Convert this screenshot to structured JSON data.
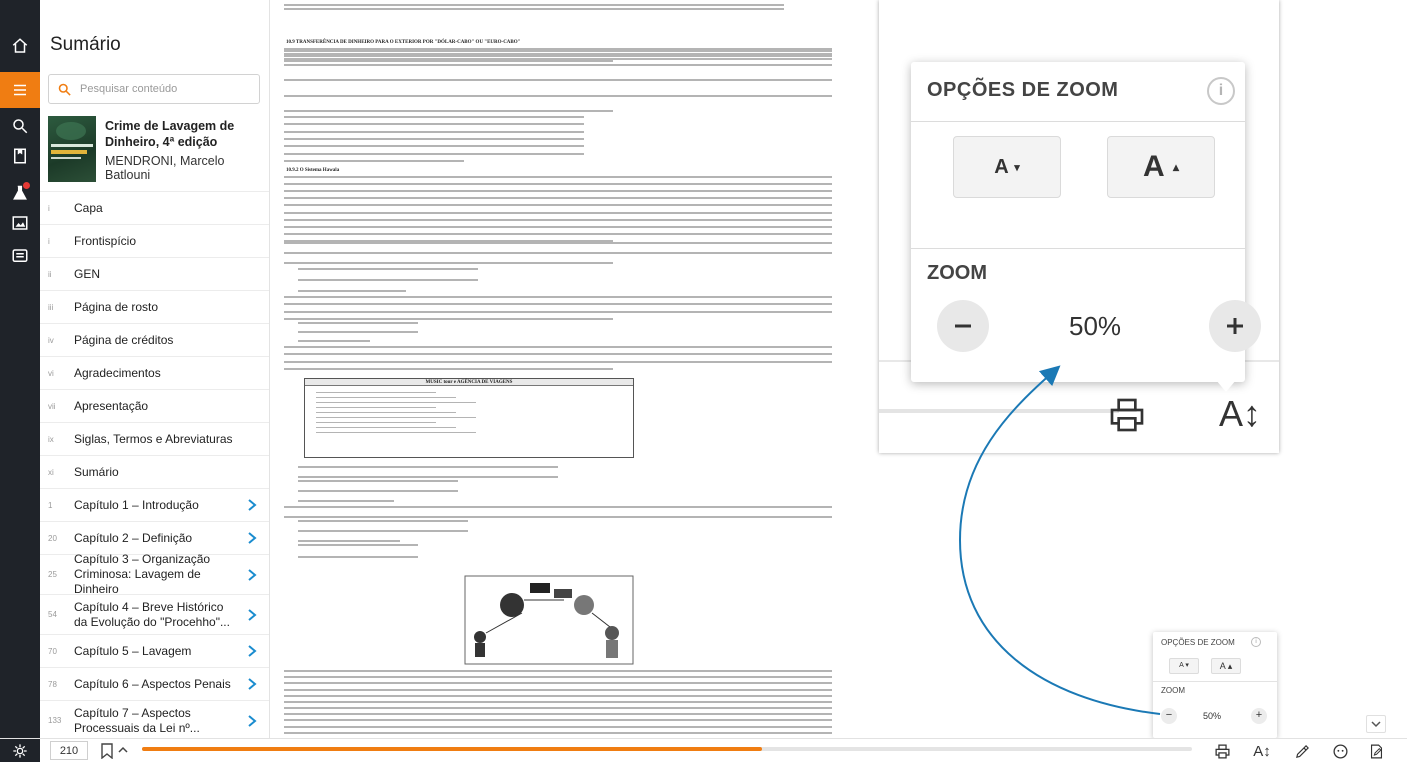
{
  "rail": {
    "items": [
      {
        "icon": "home-icon"
      },
      {
        "icon": "toc-icon",
        "active": true
      },
      {
        "icon": "search-icon"
      },
      {
        "icon": "bookmark-icon"
      },
      {
        "icon": "flask-icon",
        "badge": true
      },
      {
        "icon": "image-icon"
      },
      {
        "icon": "notes-icon"
      }
    ]
  },
  "sidebar": {
    "title": "Sumário",
    "search_placeholder": "Pesquisar conteúdo",
    "book": {
      "title": "Crime de Lavagem de Dinheiro, 4ª edição",
      "author": "MENDRONI, Marcelo Batlouni"
    },
    "toc": [
      {
        "num": "i",
        "label": "Capa",
        "chevron": false
      },
      {
        "num": "i",
        "label": "Frontispício",
        "chevron": false
      },
      {
        "num": "ii",
        "label": "GEN",
        "chevron": false
      },
      {
        "num": "iii",
        "label": "Página de rosto",
        "chevron": false
      },
      {
        "num": "iv",
        "label": "Página de créditos",
        "chevron": false
      },
      {
        "num": "vi",
        "label": "Agradecimentos",
        "chevron": false
      },
      {
        "num": "vii",
        "label": "Apresentação",
        "chevron": false
      },
      {
        "num": "ix",
        "label": "Siglas, Termos e Abreviaturas",
        "chevron": false
      },
      {
        "num": "xi",
        "label": "Sumário",
        "chevron": false
      },
      {
        "num": "1",
        "label": "Capítulo 1 – Introdução",
        "chevron": true
      },
      {
        "num": "20",
        "label": "Capítulo 2 – Definição",
        "chevron": true
      },
      {
        "num": "25",
        "label": "Capítulo 3 – Organização Criminosa: Lavagem de Dinheiro",
        "chevron": true
      },
      {
        "num": "54",
        "label": "Capítulo 4 – Breve Histórico da Evolução do \"Procehho\"...",
        "chevron": true
      },
      {
        "num": "70",
        "label": "Capítulo 5 – Lavagem",
        "chevron": true
      },
      {
        "num": "78",
        "label": "Capítulo 6 – Aspectos Penais",
        "chevron": true
      },
      {
        "num": "133",
        "label": "Capítulo 7 – Aspectos Processuais da Lei nº...",
        "chevron": true
      }
    ]
  },
  "bottombar": {
    "page_number": "210",
    "progress": 0.59,
    "font_icon_label": "A↕"
  },
  "document": {
    "heading1": "10.9   TRANSFERÊNCIA DE DINHEIRO PARA O EXTERIOR POR \"DÓLAR-CABO\" OU \"EURO-CABO\"",
    "heading2": "10.9.2   O Sistema Hawala",
    "box_title": "MUSIC tour e AGÊNCIA DE VIAGENS"
  },
  "zoom_small": {
    "title": "OPÇÕES DE ZOOM",
    "info": "i",
    "decrease_label": "A",
    "increase_label": "A",
    "zoom_label": "ZOOM",
    "minus": "−",
    "plus": "+",
    "value": "50%"
  },
  "zoom_callout": {
    "title": "OPÇÕES DE ZOOM",
    "info": "i",
    "decrease_label": "A",
    "increase_label": "A",
    "zoom_label": "ZOOM",
    "value": "50%",
    "aa_label": "A↕"
  },
  "colors": {
    "accent": "#f07d12",
    "rail": "#1f2329",
    "link_blue": "#1a8ccf",
    "arrow_blue": "#1b79b5"
  }
}
